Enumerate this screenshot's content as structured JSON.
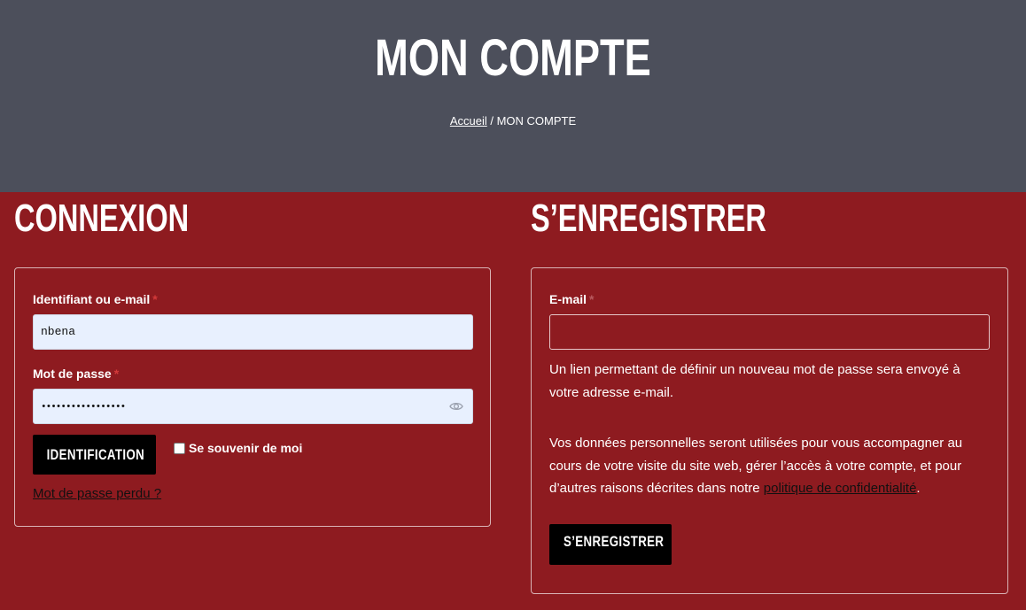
{
  "header": {
    "title": "MON COMPTE",
    "breadcrumb_home": "Accueil",
    "breadcrumb_separator": " / ",
    "breadcrumb_current": "MON COMPTE"
  },
  "login": {
    "title": "CONNEXION",
    "username_label": "Identifiant ou e-mail",
    "username_value": "nbena",
    "password_label": "Mot de passe",
    "password_value": "•••••••••••••••••",
    "required_mark": "*",
    "submit_label": "IDENTIFICATION",
    "remember_label": "Se souvenir de moi",
    "lost_password_link": "Mot de passe perdu ?"
  },
  "register": {
    "title": "S’ENREGISTRER",
    "email_label": "E-mail",
    "required_mark": "*",
    "email_value": "",
    "info_text": "Un lien permettant de définir un nouveau mot de passe sera envoyé à votre adresse e-mail.",
    "privacy_text": "Vos données personnelles seront utilisées pour vous accompagner au cours de votre visite du site web, gérer l’accès à votre compte, et pour d’autres raisons décrites dans notre ",
    "privacy_link": "politique de confidentialité",
    "privacy_end": ".",
    "submit_label": "S’ENREGISTRER"
  },
  "icons": {
    "eye": "eye-icon"
  },
  "colors": {
    "header_bg": "#4c4f5b",
    "content_bg": "#8e1b20",
    "button_bg": "#000000",
    "input_autofill_bg": "#e8f0fe"
  }
}
